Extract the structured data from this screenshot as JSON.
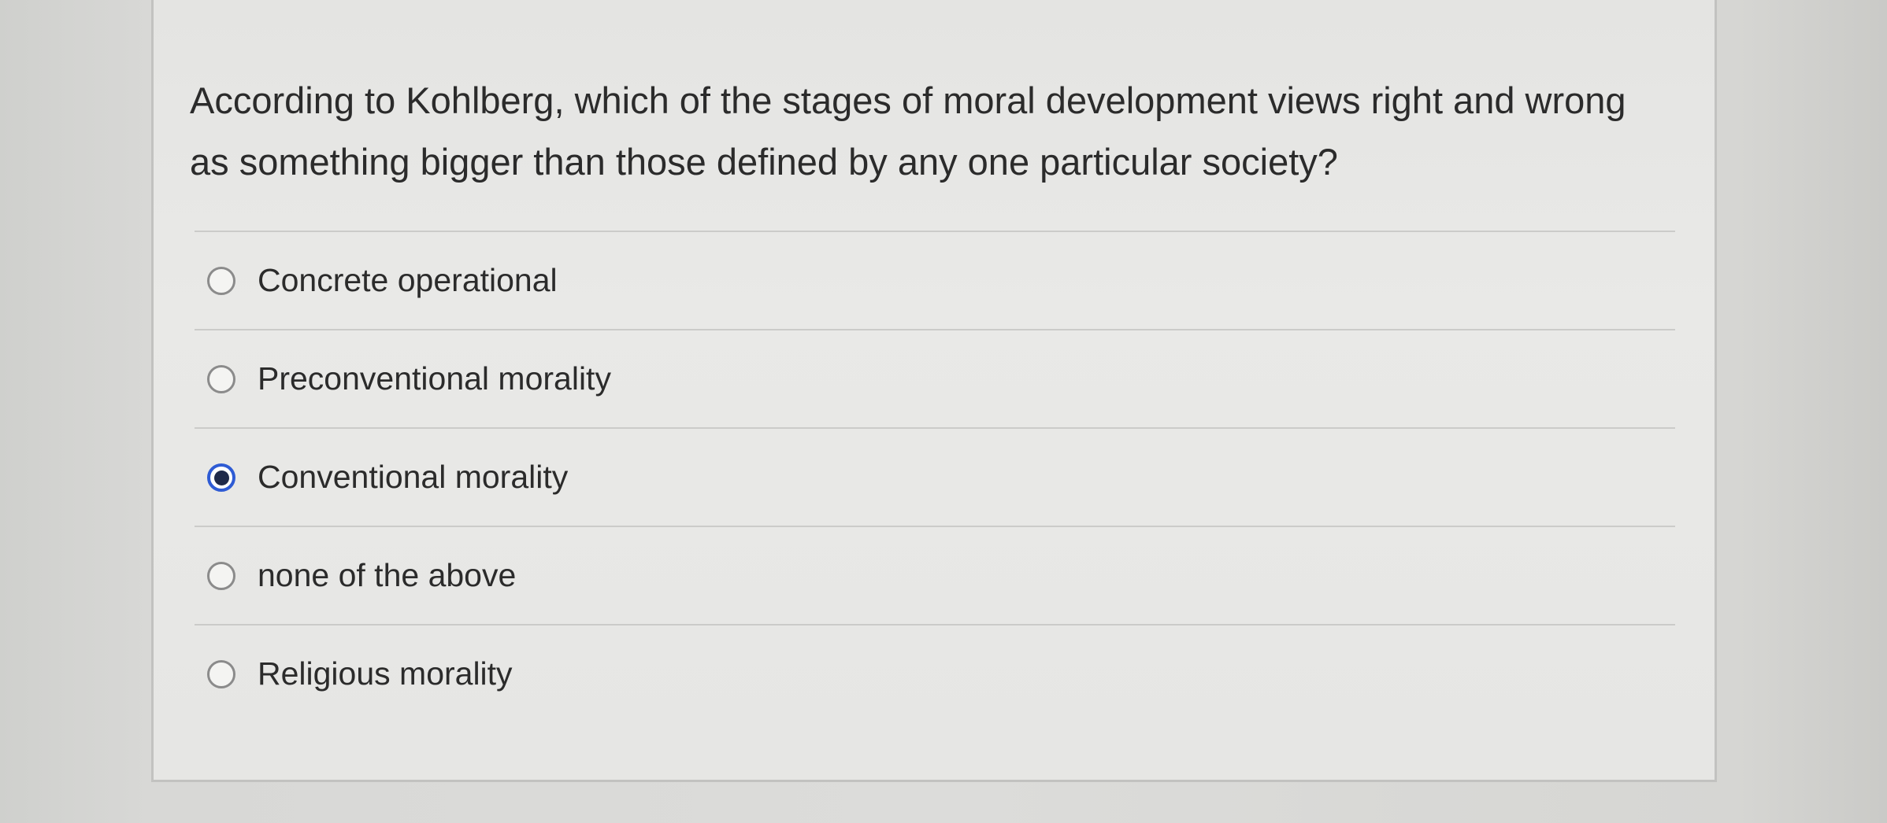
{
  "question": {
    "text": "According to Kohlberg, which of the stages of moral development views right and wrong as something bigger than those defined by any one particular society?"
  },
  "answers": [
    {
      "label": "Concrete operational",
      "selected": false
    },
    {
      "label": "Preconventional morality",
      "selected": false
    },
    {
      "label": "Conventional morality",
      "selected": true
    },
    {
      "label": "none of the above",
      "selected": false
    },
    {
      "label": "Religious morality",
      "selected": false
    }
  ],
  "colors": {
    "selected_accent": "#2e5bd4",
    "text": "#2b2b2b",
    "background": "#e8e8e6"
  },
  "icons": {
    "radio_unselected": "radio-empty-circle",
    "radio_selected": "radio-filled-circle"
  }
}
